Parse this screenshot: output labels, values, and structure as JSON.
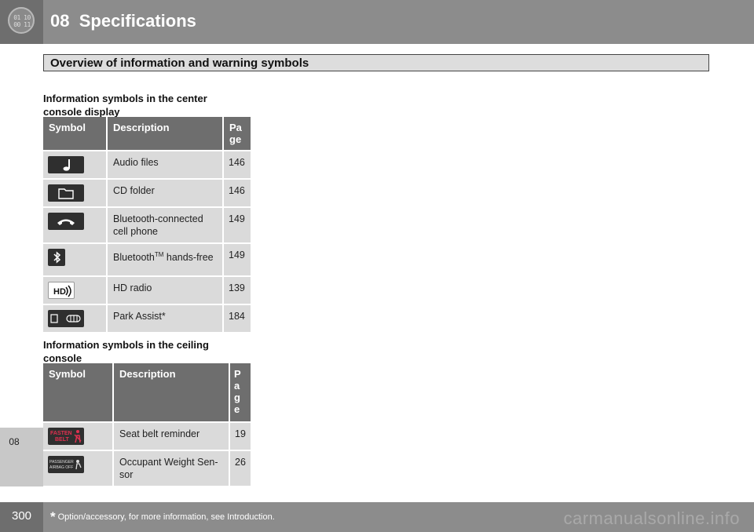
{
  "header": {
    "badge_lines": [
      "01 10",
      "00 11"
    ],
    "chapter_number": "08",
    "chapter_title": "Specifications"
  },
  "side_tab": "08",
  "section_title": "Overview of information and warning symbols",
  "center_console": {
    "heading": "Information symbols in the center console display",
    "columns": [
      "Symbol",
      "Description",
      "Pa ge"
    ],
    "rows": [
      {
        "icon": "music-note-icon",
        "description": "Audio files",
        "page": "146"
      },
      {
        "icon": "folder-icon",
        "description": "CD folder",
        "page": "146"
      },
      {
        "icon": "phone-handset-icon",
        "description": "Bluetooth-connected cell phone",
        "page": "149"
      },
      {
        "icon": "bluetooth-icon",
        "description_pre": "Bluetooth",
        "description_sup": "TM",
        "description_post": " hands-free",
        "page": "149"
      },
      {
        "icon": "hd-radio-icon",
        "description": "HD radio",
        "page": "139"
      },
      {
        "icon": "park-assist-icon",
        "description": "Park Assist*",
        "page": "184"
      }
    ]
  },
  "ceiling_console": {
    "heading": "Information symbols in the ceiling console",
    "columns": [
      "Symbol",
      "Description",
      "P a g e"
    ],
    "rows": [
      {
        "icon": "fasten-belt-icon",
        "icon_text": [
          "FASTEN",
          "BELT"
        ],
        "description": "Seat belt reminder",
        "page": "19"
      },
      {
        "icon": "passenger-airbag-off-icon",
        "icon_text": [
          "PASSENGER",
          "AIRBAG OFF"
        ],
        "description": "Occupant Weight Sen-sor",
        "page": "26"
      }
    ]
  },
  "footer": {
    "page_number": "300",
    "footnote_star": "*",
    "footnote_text": "Option/accessory, for more information, see Introduction.",
    "watermark": "carmanualsonline.info"
  },
  "colors": {
    "header_bg": "#8c8c8c",
    "header_badge_bg": "#6e6e6e",
    "table_header_bg": "#6e6e6e",
    "table_row_bg": "#dadada",
    "fasten_belt_text": "#e03050"
  }
}
